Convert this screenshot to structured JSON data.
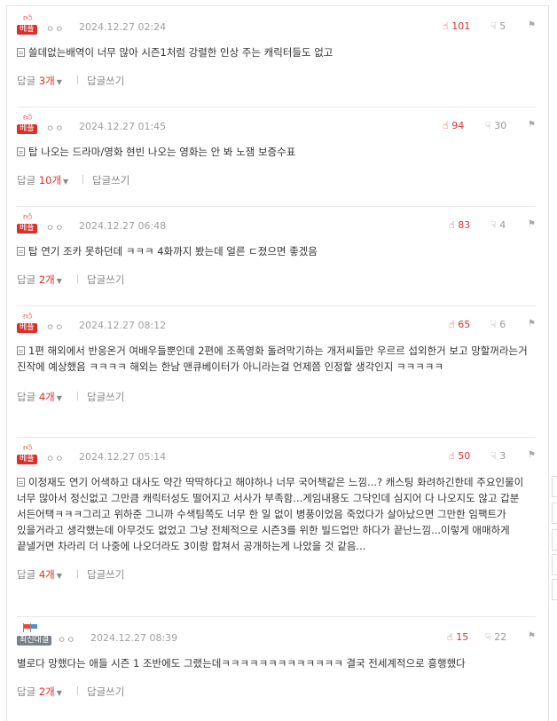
{
  "comments": [
    {
      "badge": "베플",
      "nick": "ㅇㅇ",
      "date": "2024.12.27 02:24",
      "up": "101",
      "down": "5",
      "text": "쓸데없는배역이 너무 많아 시즌1처럼 강렬한 인상 주는 캐릭터들도 없고",
      "reply_label": "답글",
      "reply_count": "3개",
      "write_label": "답글쓰기"
    },
    {
      "badge": "베플",
      "nick": "ㅇㅇ",
      "date": "2024.12.27 01:45",
      "up": "94",
      "down": "30",
      "text": "탑 나오는 드라마/영화 현빈 나오는 영화는 안 봐 노잼 보증수표",
      "reply_label": "답글",
      "reply_count": "10개",
      "write_label": "답글쓰기"
    },
    {
      "badge": "베플",
      "nick": "ㅇㅇ",
      "date": "2024.12.27 06:48",
      "up": "83",
      "down": "4",
      "text": "탑 연기 조카 못하던데 ㅋㅋㅋ 4화까지 봤는데 얼른 ㄷ졌으면 좋겠음",
      "reply_label": "답글",
      "reply_count": "2개",
      "write_label": "답글쓰기"
    },
    {
      "badge": "베플",
      "nick": "ㅇㅇ",
      "date": "2024.12.27 08:12",
      "up": "65",
      "down": "6",
      "text": "1편 해외에서 반응온거 여배우들뿐인데 2편에 조폭영화 돌려막기하는 개저씨들만 우르르 섭외한거 보고 망할꺼라는거 진작에 예상했음 ㅋㅋㅋㅋ 해외는 한남 맨큐베이터가 아니라는걸 언제쯤 인정할 생각인지 ㅋㅋㅋㅋㅋ",
      "reply_label": "답글",
      "reply_count": "4개",
      "write_label": "답글쓰기"
    },
    {
      "badge": "베플",
      "nick": "ㅇㅇ",
      "date": "2024.12.27 05:14",
      "up": "50",
      "down": "3",
      "text": "이정재도 연기 어색하고 대사도 약간 딱딱하다고 해야하나 너무 국어책같은 느낌...? 캐스팅 화려하긴한데 주요인물이 너무 많아서 정신없고 그만큼 캐릭터성도 떨어지고 서사가 부족함...게임내용도 그닥인데 심지어 다 나오지도 않고 갑분 서든어택ㅋㅋㅋ그리고 위하준 그니까 수색팀쪽도 너무 한 일 없이 병풍이었음 죽었다가 살아났으면 그만한 임팩트가 있을거라고 생각했는데 아무것도 없었고 그냥 전체적으로 시즌3를 위한 빌드업만 하다가 끝난느낌...이렇게 애매하게 끝낼거면 차라리 더 나중에 나오더라도 3이랑 합쳐서 공개하는게 나았을 것 같음...",
      "reply_label": "답글",
      "reply_count": "4개",
      "write_label": "답글쓰기"
    },
    {
      "badge": "최신대결",
      "nick": "ㅇㅇ",
      "date": "2024.12.27 08:39",
      "up": "15",
      "down": "22",
      "text": "별로다 망했다는 애들 시즌 1 조반에도 그랬는데ㅋㅋㅋㅋㅋㅋㅋㅋㅋㅋㅋㅋㅋ 결국 전세계적으로 흥행했다",
      "reply_label": "답글",
      "reply_count": "2개",
      "write_label": "답글쓰기"
    }
  ],
  "icons": {
    "thumb_up": "thumb-up-icon",
    "thumb_down": "thumb-down-icon",
    "report": "report-icon",
    "document": "document-icon",
    "caret": "caret-down-icon"
  },
  "colors": {
    "best_badge": "#d9302a",
    "up_count": "#d33333",
    "reply_count": "#d9302a"
  }
}
